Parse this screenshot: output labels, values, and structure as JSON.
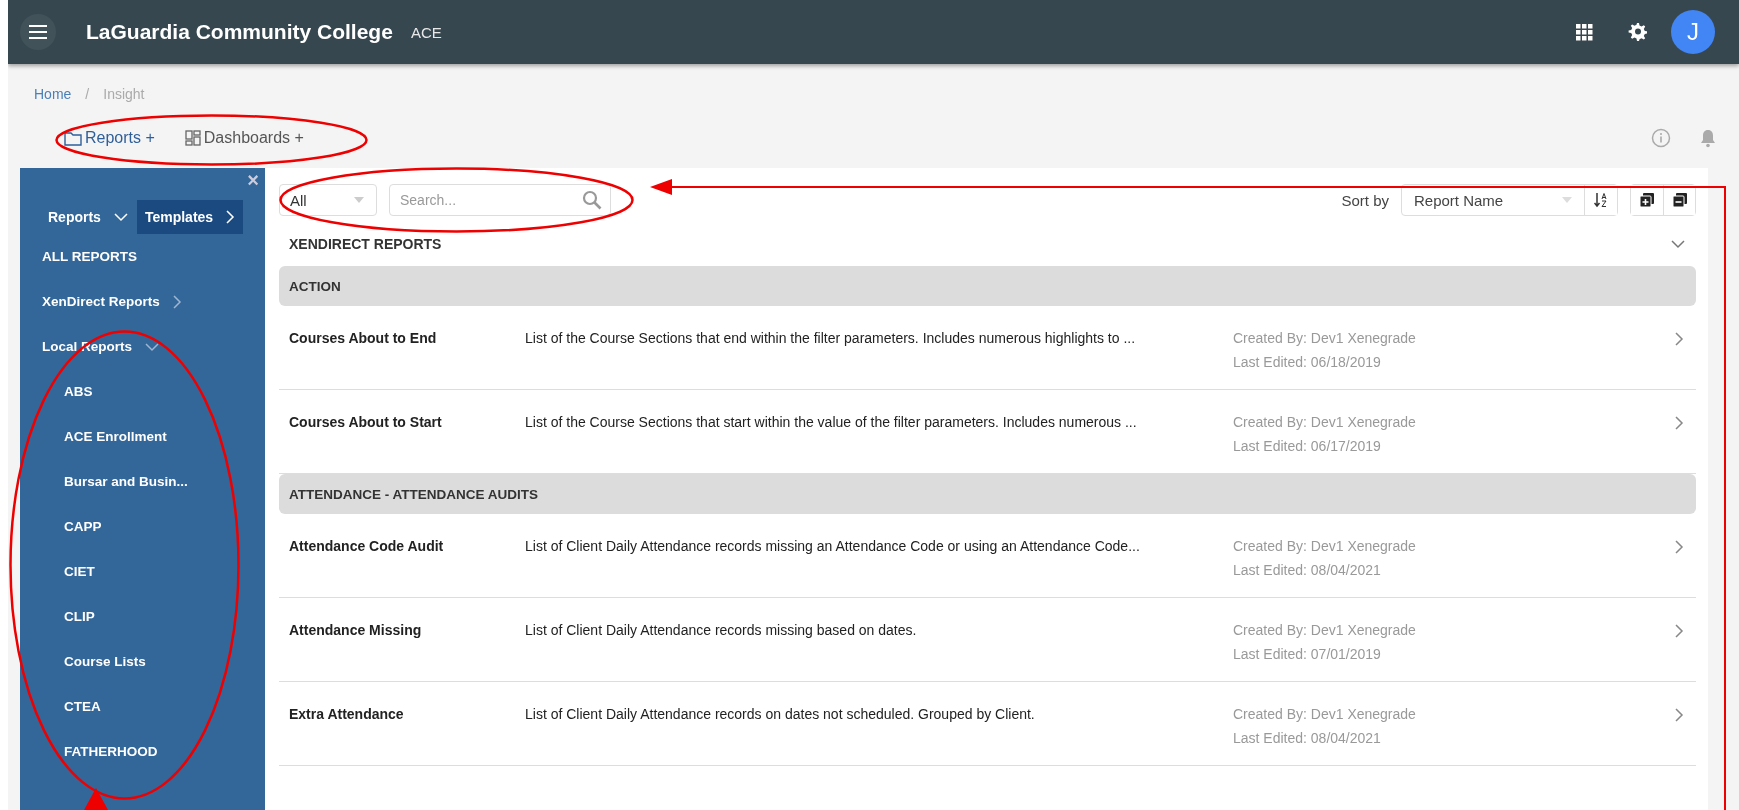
{
  "top_bar": {
    "title": "LaGuardia Community College",
    "subtitle": "ACE",
    "avatar": "J"
  },
  "breadcrumb": [
    {
      "label": "Home",
      "link": true
    },
    {
      "label": "/",
      "link": false
    },
    {
      "label": "Insight",
      "link": false
    }
  ],
  "tabs": [
    {
      "label": "Reports",
      "plus": "+",
      "selected": true
    },
    {
      "label": "Dashboards",
      "plus": "+",
      "selected": false
    }
  ],
  "sidebar": {
    "close": "×",
    "header_tabs": [
      {
        "label": "Reports",
        "selected": false,
        "expanded": true
      },
      {
        "label": "Templates",
        "selected": true,
        "expanded": false
      }
    ],
    "items": [
      {
        "label": "ALL REPORTS"
      },
      {
        "label": "XenDirect Reports",
        "expanded": false
      },
      {
        "label": "Local Reports",
        "expanded": true,
        "children": [
          {
            "label": "ABS"
          },
          {
            "label": "ACE Enrollment"
          },
          {
            "label": "Bursar and Busin..."
          },
          {
            "label": "CAPP"
          },
          {
            "label": "CIET"
          },
          {
            "label": "CLIP"
          },
          {
            "label": "Course Lists"
          },
          {
            "label": "CTEA"
          },
          {
            "label": "FATHERHOOD"
          }
        ]
      }
    ]
  },
  "filter": {
    "category": "All",
    "search_placeholder": "Search...",
    "sort_label": "Sort by",
    "sort_value": "Report Name"
  },
  "section": {
    "title": "XENDIRECT REPORTS",
    "expanded": true
  },
  "groups": [
    {
      "title": "ACTION",
      "rows": [
        {
          "name": "Courses About to End",
          "description": "List of the Course Sections that end within the filter parameters. Includes numerous highlights to ...",
          "created_by": "Created By: Dev1 Xenegrade",
          "last_edited": "Last Edited: 06/18/2019"
        },
        {
          "name": "Courses About to Start",
          "description": "List of the Course Sections that start within the value of the filter parameters. Includes numerous ...",
          "created_by": "Created By: Dev1 Xenegrade",
          "last_edited": "Last Edited: 06/17/2019"
        }
      ]
    },
    {
      "title": "ATTENDANCE - ATTENDANCE AUDITS",
      "rows": [
        {
          "name": "Attendance Code Audit",
          "description": "List of Client Daily Attendance records missing an Attendance Code or using an Attendance Code...",
          "created_by": "Created By: Dev1 Xenegrade",
          "last_edited": "Last Edited: 08/04/2021"
        },
        {
          "name": "Attendance Missing",
          "description": "List of Client Daily Attendance records missing based on dates.",
          "created_by": "Created By: Dev1 Xenegrade",
          "last_edited": "Last Edited: 07/01/2019"
        },
        {
          "name": "Extra Attendance",
          "description": "List of Client Daily Attendance records on dates not scheduled. Grouped by Client.",
          "created_by": "Created By: Dev1 Xenegrade",
          "last_edited": "Last Edited: 08/04/2021"
        }
      ]
    }
  ],
  "annotations": [
    {
      "kind": "ellipse"
    },
    {
      "kind": "ellipse"
    },
    {
      "kind": "ellipse"
    },
    {
      "kind": "elbow-arrow"
    },
    {
      "kind": "up-arrow"
    }
  ]
}
